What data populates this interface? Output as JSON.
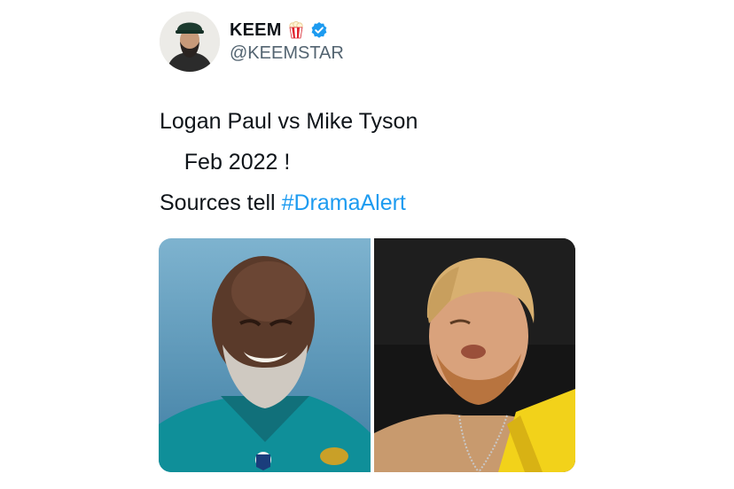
{
  "author": {
    "name": "KEEM",
    "handle": "@KEEMSTAR",
    "badges": [
      "popcorn-icon",
      "verified-icon"
    ],
    "verified_color": "#1d9bf0"
  },
  "tweet": {
    "lines": [
      {
        "text": "Logan Paul vs Mike Tyson"
      },
      {
        "text": "    Feb 2022 !"
      },
      {
        "prefix": "Sources tell ",
        "hashtag": "#DramaAlert"
      }
    ],
    "hashtag_color": "#1d9bf0"
  },
  "media": {
    "images": [
      {
        "subject": "smiling-boxer-photo"
      },
      {
        "subject": "blond-fighter-photo"
      }
    ]
  }
}
